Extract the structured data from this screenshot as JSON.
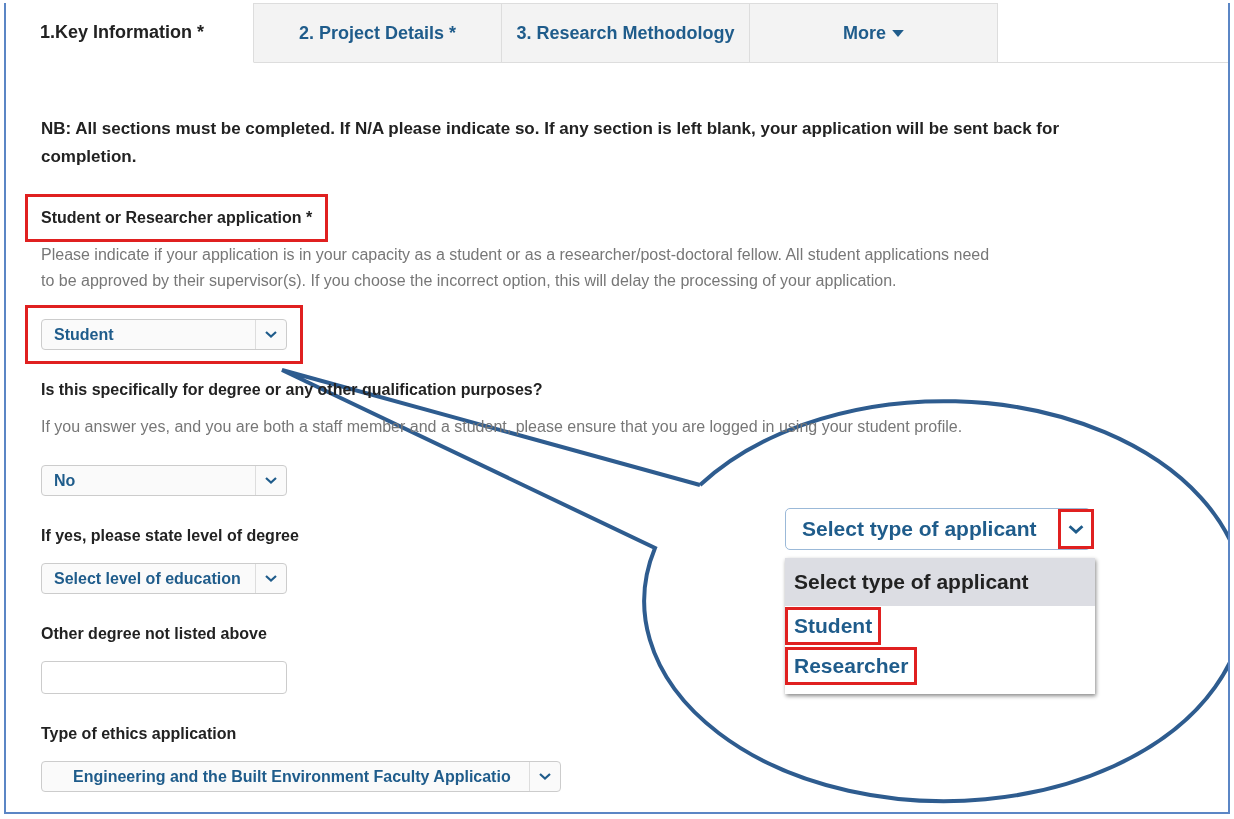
{
  "tabs": [
    {
      "label": "1.Key Information *",
      "selected": true,
      "kind": "tab"
    },
    {
      "label": "2. Project Details *",
      "selected": false,
      "kind": "tab"
    },
    {
      "label": "3. Research Methodology",
      "selected": false,
      "kind": "tab"
    },
    {
      "label": "More",
      "selected": false,
      "kind": "menu"
    }
  ],
  "notice": "NB: All sections must be completed. If N/A please indicate so. If any section is left blank, your application will be sent back for completion.",
  "fields": [
    {
      "kind": "select",
      "label": "Student or Researcher application *",
      "label_highlighted": true,
      "help": "Please indicate if your application is in your capacity as a student or as a researcher/post-doctoral fellow. All student applications need to be approved by their supervisor(s). If you choose the incorrect option, this will delay the processing of your application.",
      "value": "Student",
      "highlighted": true
    },
    {
      "kind": "select",
      "label": "Is this specifically for degree or any other qualification purposes?",
      "label_highlighted": false,
      "help": "If you answer yes, and you are both a staff member and a student, please ensure that you are logged in using your student profile.",
      "value": "No",
      "highlighted": false
    },
    {
      "kind": "select",
      "label": "If yes, please state level of degree",
      "label_highlighted": false,
      "value": "Select level of education",
      "highlighted": false
    },
    {
      "kind": "text",
      "label": "Other degree not listed above",
      "label_highlighted": false,
      "highlighted": false
    },
    {
      "kind": "wide-select",
      "label": "Type of ethics application",
      "label_highlighted": false,
      "value": "Engineering and the Built Environment Faculty Applicatio",
      "highlighted": false
    }
  ],
  "callout": {
    "value": "Select type of applicant",
    "toggle_highlighted": true,
    "options": [
      {
        "label": "Select type of applicant",
        "selected": true,
        "highlighted": false
      },
      {
        "label": "Student",
        "selected": false,
        "highlighted": true
      },
      {
        "label": "Researcher",
        "selected": false,
        "highlighted": true
      }
    ]
  }
}
